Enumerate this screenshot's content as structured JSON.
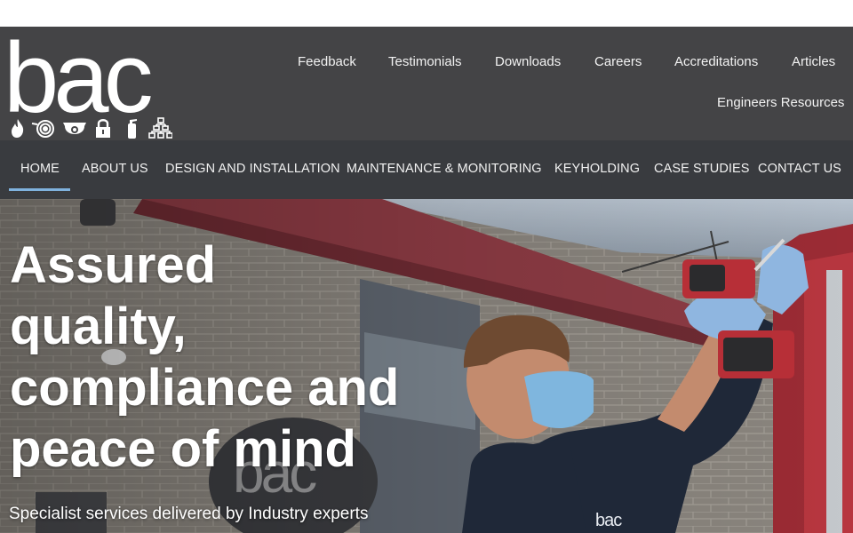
{
  "brand": {
    "logo_text": "bac",
    "logo_icons": [
      "flame-icon",
      "hose-reel-icon",
      "cctv-camera-icon",
      "padlock-icon",
      "extinguisher-icon",
      "network-icon"
    ]
  },
  "utility_nav": {
    "items": [
      {
        "label": "Feedback"
      },
      {
        "label": "Testimonials"
      },
      {
        "label": "Downloads"
      },
      {
        "label": "Careers"
      },
      {
        "label": "Accreditations"
      },
      {
        "label": "Articles"
      },
      {
        "label": "Engineers Resources"
      }
    ]
  },
  "main_nav": {
    "active": "HOME",
    "items": [
      {
        "label": "HOME"
      },
      {
        "label": "ABOUT US"
      },
      {
        "label": "DESIGN AND INSTALLATION"
      },
      {
        "label": "MAINTENANCE & MONITORING"
      },
      {
        "label": "KEYHOLDING"
      },
      {
        "label": "CASE STUDIES"
      },
      {
        "label": "CONTACT US"
      }
    ]
  },
  "hero": {
    "title_lines": [
      "Assured",
      "quality,",
      "compliance and",
      "peace of mind"
    ],
    "subtitle": "Specialist services delivered by Industry experts",
    "shirt_logo": "bac"
  },
  "colors": {
    "header_bg": "#444446",
    "nav_bg": "#393b3f",
    "active_underline": "#7fb2de",
    "text": "#f2f2f2"
  }
}
